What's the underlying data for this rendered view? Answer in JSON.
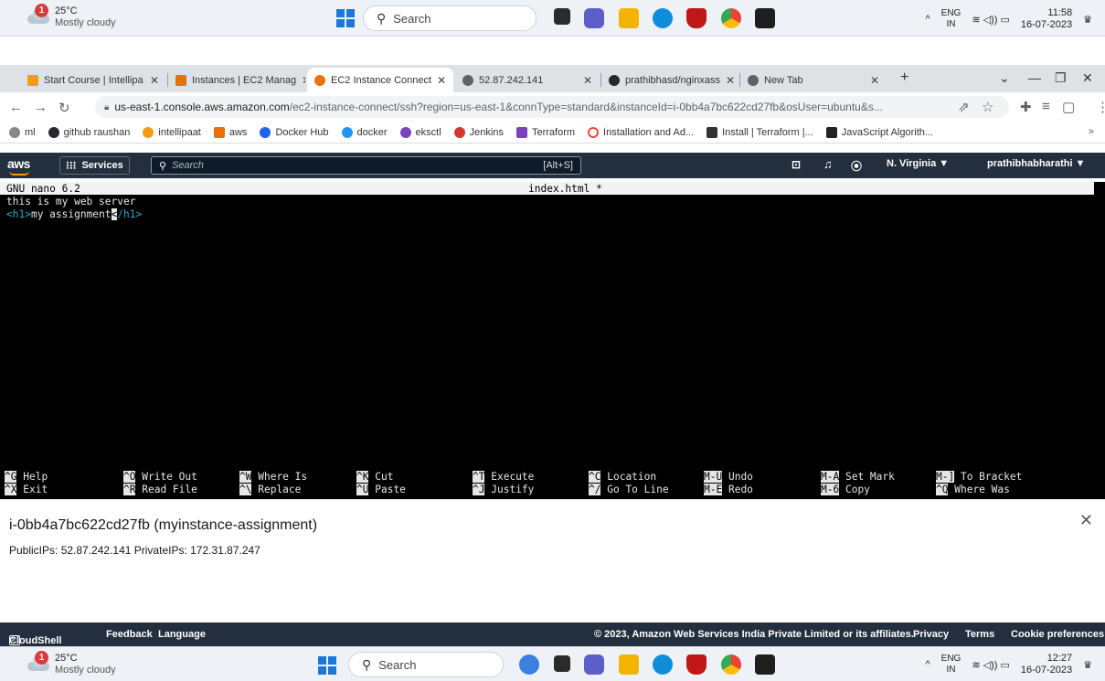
{
  "taskbar_top": {
    "weather_badge": "1",
    "temp": "25°C",
    "condition": "Mostly cloudy",
    "search_label": "Search",
    "lang_line1": "ENG",
    "lang_line2": "IN",
    "time": "11:58",
    "date": "16-07-2023"
  },
  "tabs": [
    {
      "label": "Start Course | Intellipa",
      "color": "#f39c12"
    },
    {
      "label": "Instances | EC2 Manag",
      "color": "#e8710a"
    },
    {
      "label": "EC2 Instance Connect",
      "color": "#ec7211"
    },
    {
      "label": "52.87.242.141",
      "color": "#5f6368"
    },
    {
      "label": "prathibhasd/nginxass",
      "color": "#24292e"
    },
    {
      "label": "New Tab",
      "color": "#5f6368"
    }
  ],
  "browser": {
    "url_host": "us-east-1.console.aws.amazon.com",
    "url_path": "/ec2-instance-connect/ssh?region=us-east-1&connType=standard&instanceId=i-0bb4a7bc622cd27fb&osUser=ubuntu&s..."
  },
  "bookmarks": [
    {
      "label": "ml",
      "color": "#888"
    },
    {
      "label": "github raushan",
      "color": "#24292e"
    },
    {
      "label": "intellipaat",
      "color": "#f39c12"
    },
    {
      "label": "aws",
      "color": "#e8710a"
    },
    {
      "label": "Docker Hub",
      "color": "#1d63ed"
    },
    {
      "label": "docker",
      "color": "#2496ed"
    },
    {
      "label": "eksctl",
      "color": "#7b42bc"
    },
    {
      "label": "Jenkins",
      "color": "#d33833"
    },
    {
      "label": "Terraform",
      "color": "#7b42bc"
    },
    {
      "label": "Installation and Ad...",
      "color": "#e84c3d"
    },
    {
      "label": "Install | Terraform |...",
      "color": "#333"
    },
    {
      "label": "JavaScript Algorith...",
      "color": "#222"
    }
  ],
  "aws": {
    "logo": "aws",
    "services": "Services",
    "search_placeholder": "Search",
    "search_shortcut": "[Alt+S]",
    "region": "N. Virginia ▼",
    "user": "prathibhabharathi ▼"
  },
  "nano": {
    "version": "GNU nano 6.2",
    "filename": "index.html *",
    "line1": "this is my web server",
    "line2_open": "<h1>",
    "line2_text": "my assignment",
    "line2_cursor": "<",
    "line2_close": "/h1>",
    "shortcuts_row1": [
      {
        "key": "^G",
        "label": "Help"
      },
      {
        "key": "^O",
        "label": "Write Out"
      },
      {
        "key": "^W",
        "label": "Where Is"
      },
      {
        "key": "^K",
        "label": "Cut"
      },
      {
        "key": "^T",
        "label": "Execute"
      },
      {
        "key": "^C",
        "label": "Location"
      },
      {
        "key": "M-U",
        "label": "Undo"
      },
      {
        "key": "M-A",
        "label": "Set Mark"
      },
      {
        "key": "M-]",
        "label": "To Bracket"
      }
    ],
    "shortcuts_row2": [
      {
        "key": "^X",
        "label": "Exit"
      },
      {
        "key": "^R",
        "label": "Read File"
      },
      {
        "key": "^\\",
        "label": "Replace"
      },
      {
        "key": "^U",
        "label": "Paste"
      },
      {
        "key": "^J",
        "label": "Justify"
      },
      {
        "key": "^/",
        "label": "Go To Line"
      },
      {
        "key": "M-E",
        "label": "Redo"
      },
      {
        "key": "M-6",
        "label": "Copy"
      },
      {
        "key": "^Q",
        "label": "Where Was"
      }
    ]
  },
  "instance": {
    "title": "i-0bb4a7bc622cd27fb (myinstance-assignment)",
    "ips": "PublicIPs: 52.87.242.141   PrivateIPs: 172.31.87.247"
  },
  "footer": {
    "cloudshell": "CloudShell",
    "feedback": "Feedback",
    "language": "Language",
    "copyright": "© 2023, Amazon Web Services India Private Limited or its affiliates.",
    "privacy": "Privacy",
    "terms": "Terms",
    "cookies": "Cookie preferences"
  },
  "taskbar_bottom": {
    "weather_badge": "1",
    "temp": "25°C",
    "condition": "Mostly cloudy",
    "search_label": "Search",
    "lang_line1": "ENG",
    "lang_line2": "IN",
    "time": "12:27",
    "date": "16-07-2023"
  }
}
